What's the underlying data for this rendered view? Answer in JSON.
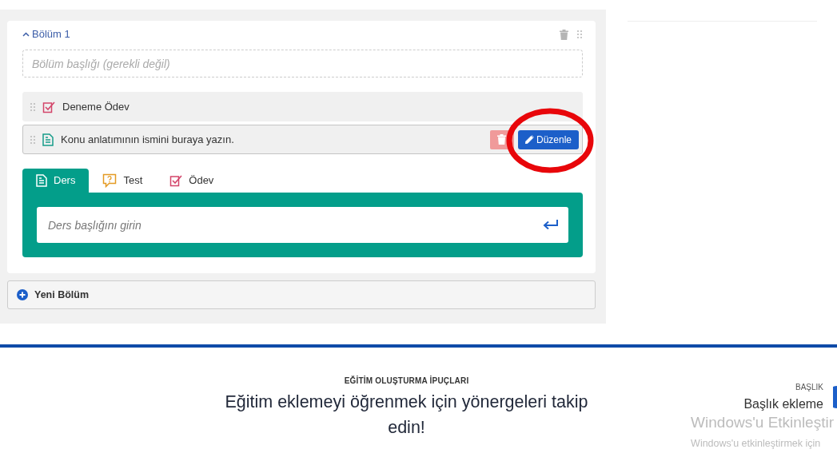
{
  "section": {
    "title": "Bölüm 1",
    "expanded": true,
    "title_placeholder": "Bölüm başlığı (gerekli değil)"
  },
  "items": [
    {
      "kind": "assignment",
      "title": "Deneme Ödev",
      "selected": false
    },
    {
      "kind": "lesson",
      "title": "Konu anlatımının ismini buraya yazın.",
      "selected": true,
      "edit_label": "Düzenle"
    }
  ],
  "tabs": [
    {
      "kind": "lesson",
      "label": "Ders",
      "selected": true
    },
    {
      "kind": "quiz",
      "label": "Test",
      "selected": false
    },
    {
      "kind": "assignment",
      "label": "Ödev",
      "selected": false
    }
  ],
  "lesson_input": {
    "placeholder": "Ders başlığını girin"
  },
  "new_section": {
    "label": "Yeni Bölüm"
  },
  "tips": {
    "eyebrow": "EĞİTİM OLUŞTURMA İPUÇLARI",
    "headline": "Eğitim eklemeyi öğrenmek için yönergeleri takip edin!"
  },
  "side_step": {
    "eyebrow": "BAŞLIK",
    "title": "Başlık ekleme"
  },
  "os_overlay": {
    "title": "Windows'u Etkinleştir",
    "subtitle": "Windows'u etkinleştirmek için"
  }
}
